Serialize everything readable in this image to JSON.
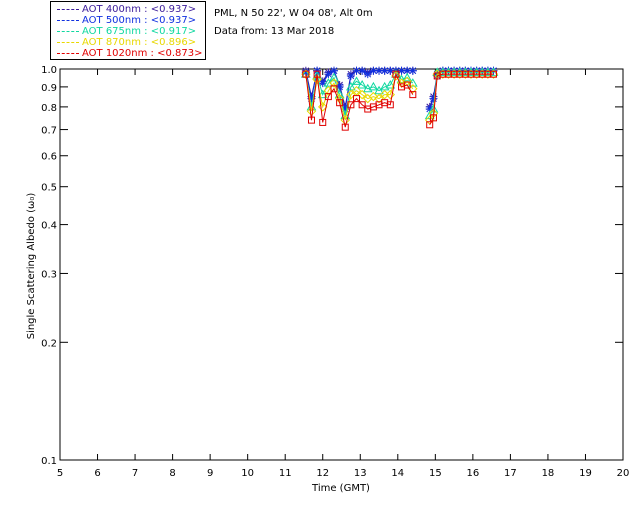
{
  "header": {
    "site": "PML, N 50 22', W 04 08', Alt 0m",
    "date": "Data from: 13 Mar 2018"
  },
  "legend": [
    {
      "label": "AOT  400nm : <0.937>",
      "color": "#3a1a9a"
    },
    {
      "label": "AOT  500nm : <0.937>",
      "color": "#1030e0"
    },
    {
      "label": "AOT  675nm : <0.917>",
      "color": "#10d8a0"
    },
    {
      "label": "AOT  870nm : <0.896>",
      "color": "#e8d800"
    },
    {
      "label": "AOT 1020nm : <0.873>",
      "color": "#e00000"
    }
  ],
  "chart_data": {
    "type": "line",
    "xlabel": "Time (GMT)",
    "ylabel": "Single Scattering Albedo (ω₀)",
    "xlim": [
      5,
      20
    ],
    "ylim": [
      0.1,
      1.0
    ],
    "yscale": "log",
    "xticks": [
      "5",
      "6",
      "7",
      "8",
      "9",
      "10",
      "11",
      "12",
      "13",
      "14",
      "15",
      "16",
      "17",
      "18",
      "19",
      "20"
    ],
    "yticks": [
      {
        "value": 0.1,
        "label": "0.1"
      },
      {
        "value": 0.2,
        "label": "0.2"
      },
      {
        "value": 0.3,
        "label": "0.3"
      },
      {
        "value": 0.4,
        "label": "0.4"
      },
      {
        "value": 0.5,
        "label": "0.5"
      },
      {
        "value": 0.6,
        "label": "0.6"
      },
      {
        "value": 0.7,
        "label": "0.7"
      },
      {
        "value": 0.8,
        "label": "0.8"
      },
      {
        "value": 0.9,
        "label": "0.9"
      },
      {
        "value": 1.0,
        "label": "1.0"
      }
    ],
    "grid": false,
    "x": [
      11.55,
      11.7,
      11.85,
      12.0,
      12.15,
      12.3,
      12.45,
      12.6,
      12.75,
      12.9,
      13.05,
      13.2,
      13.35,
      13.5,
      13.65,
      13.8,
      13.95,
      14.1,
      14.25,
      14.4,
      14.85,
      14.95,
      15.05,
      15.2,
      15.35,
      15.5,
      15.65,
      15.8,
      15.95,
      16.1,
      16.25,
      16.4,
      16.55
    ],
    "series": [
      {
        "name": "AOT  400nm : <0.937>",
        "color": "#3a1a9a",
        "marker": "star",
        "values": [
          0.99,
          0.85,
          0.99,
          0.93,
          0.98,
          0.99,
          0.91,
          0.8,
          0.97,
          0.99,
          0.99,
          0.98,
          0.99,
          0.99,
          0.99,
          0.99,
          0.99,
          0.99,
          0.99,
          0.99,
          0.8,
          0.85,
          0.97,
          0.99,
          0.99,
          0.99,
          0.99,
          0.99,
          0.99,
          0.99,
          0.99,
          0.99,
          0.99
        ]
      },
      {
        "name": "AOT  500nm : <0.937>",
        "color": "#1030e0",
        "marker": "star",
        "values": [
          0.98,
          0.84,
          0.99,
          0.92,
          0.97,
          0.99,
          0.9,
          0.79,
          0.96,
          0.99,
          0.99,
          0.97,
          0.99,
          0.99,
          0.99,
          0.99,
          0.99,
          0.99,
          0.99,
          0.99,
          0.79,
          0.84,
          0.96,
          0.99,
          0.99,
          0.99,
          0.99,
          0.99,
          0.99,
          0.99,
          0.99,
          0.99,
          0.99
        ]
      },
      {
        "name": "AOT  675nm : <0.917>",
        "color": "#10d8a0",
        "marker": "triangle",
        "values": [
          0.97,
          0.8,
          0.96,
          0.86,
          0.92,
          0.95,
          0.86,
          0.76,
          0.9,
          0.93,
          0.91,
          0.89,
          0.9,
          0.88,
          0.9,
          0.91,
          0.97,
          0.94,
          0.95,
          0.92,
          0.76,
          0.79,
          0.98,
          0.98,
          0.98,
          0.98,
          0.98,
          0.98,
          0.98,
          0.98,
          0.98,
          0.98,
          0.98
        ]
      },
      {
        "name": "AOT  870nm : <0.896>",
        "color": "#e8d800",
        "marker": "diamond",
        "values": [
          0.97,
          0.78,
          0.94,
          0.8,
          0.88,
          0.92,
          0.84,
          0.74,
          0.86,
          0.88,
          0.86,
          0.84,
          0.85,
          0.84,
          0.86,
          0.86,
          0.96,
          0.92,
          0.93,
          0.89,
          0.74,
          0.77,
          0.97,
          0.97,
          0.97,
          0.97,
          0.97,
          0.97,
          0.97,
          0.97,
          0.97,
          0.97,
          0.97
        ]
      },
      {
        "name": "AOT 1020nm : <0.873>",
        "color": "#e00000",
        "marker": "square",
        "values": [
          0.97,
          0.74,
          0.97,
          0.73,
          0.85,
          0.89,
          0.82,
          0.71,
          0.81,
          0.84,
          0.81,
          0.79,
          0.8,
          0.81,
          0.82,
          0.81,
          0.97,
          0.9,
          0.91,
          0.86,
          0.72,
          0.75,
          0.96,
          0.97,
          0.97,
          0.97,
          0.97,
          0.97,
          0.97,
          0.97,
          0.97,
          0.97,
          0.97
        ]
      }
    ]
  }
}
